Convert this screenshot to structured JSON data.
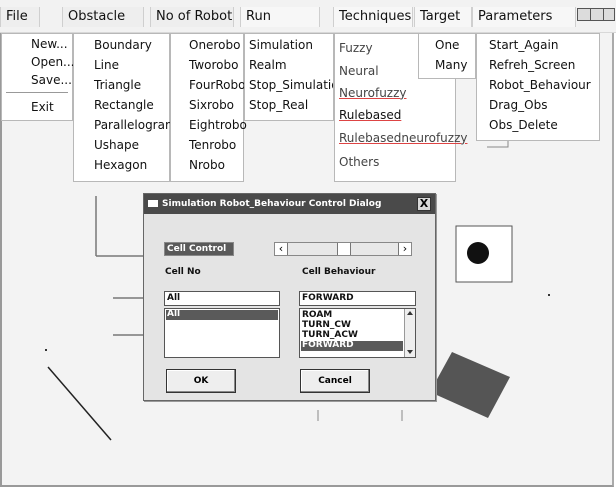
{
  "menubar": {
    "tabs": [
      "File",
      "Obstacle",
      "No of Robot",
      "Run",
      "Techniques",
      "Target",
      "Parameters"
    ]
  },
  "file_menu": [
    "New...",
    "Open...",
    "Save...",
    "Exit"
  ],
  "obstacle_menu": [
    "Boundary",
    "Line",
    "Triangle",
    "Rectangle",
    "Parallelogram",
    "Ushape",
    "Hexagon"
  ],
  "robot_menu": [
    "Onerobo",
    "Tworobo",
    "FourRobo",
    "Sixrobo",
    "Eightrobo",
    "Tenrobo",
    "Nrobo"
  ],
  "run_menu": [
    "Simulation",
    "Realm",
    "Stop_Simulation",
    "Stop_Real"
  ],
  "techniques_menu": [
    "Fuzzy",
    "Neural",
    "Neurofuzzy",
    "Rulebased",
    "Rulebasedneurofuzzy",
    "Others"
  ],
  "target_menu": [
    "One",
    "Many"
  ],
  "parameters_menu": [
    "Start_Again",
    "Refreh_Screen",
    "Robot_Behaviour",
    "Drag_Obs",
    "Obs_Delete"
  ],
  "dialog": {
    "title": "Simulation Robot_Behaviour Control Dialog",
    "close_label": "X",
    "cell_control_label": "Cell Control",
    "cell_no_label": "Cell No",
    "cell_behaviour_label": "Cell Behaviour",
    "cell_no_value": "All",
    "cell_no_items": [
      "All"
    ],
    "behaviour_value": "FORWARD",
    "behaviour_items": [
      "ROAM",
      "TURN_CW",
      "TURN_ACW",
      "FORWARD"
    ],
    "ok_label": "OK",
    "cancel_label": "Cancel",
    "slider_left_arrow": "‹",
    "slider_right_arrow": "›"
  },
  "colors": {
    "menubar": "#f2f2f2",
    "selection": "#5a5a5a",
    "title_bar": "#4a4a4a",
    "obstacle": "#555555"
  }
}
